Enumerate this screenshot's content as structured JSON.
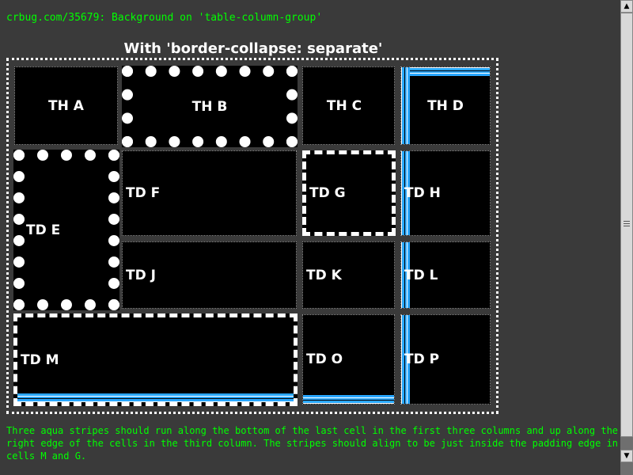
{
  "header": {
    "link_text": "crbug.com/35679: Background on 'table-column-group'"
  },
  "table": {
    "caption": "With 'border-collapse: separate'",
    "cells": {
      "a": "TH A",
      "b": "TH B",
      "c": "TH C",
      "d": "TH D",
      "e": "TD E",
      "f": "TD F",
      "g": "TD G",
      "h": "TD H",
      "j": "TD J",
      "k": "TD K",
      "l": "TD L",
      "m": "TD M",
      "o": "TD O",
      "p": "TD P"
    }
  },
  "footer": {
    "description": "Three aqua stripes should run along the bottom of the last cell in the first three columns and up along the right edge of the cells in the third column. The stripes should align to be just inside the padding edge in cells M and G."
  },
  "colors": {
    "page_background": "#3a3a3a",
    "text_green": "#00ff00",
    "cell_background": "#000000",
    "stripe_aqua": "#29a7ff",
    "border_white": "#ffffff"
  },
  "scrollbar": {
    "up_icon": "arrow-up-icon",
    "down_icon": "arrow-down-icon"
  }
}
